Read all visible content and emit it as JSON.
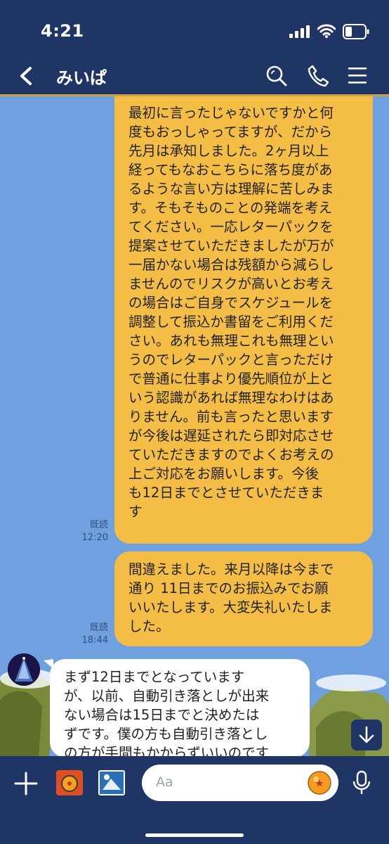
{
  "status_bar": {
    "time": "4:21"
  },
  "header": {
    "title": "みいぱ"
  },
  "messages": [
    {
      "direction": "outgoing",
      "read_label": "既読",
      "time": "12:20",
      "lines": [
        "最初に言ったじゃないですかと何",
        "度もおっしゃってますが、だから",
        "先月は承知しました。2ヶ月以上",
        "経ってもなおこちらに落ち度があ",
        "るような言い方は理解に苦しみま",
        "す。そもそものことの発端を考え",
        "てください。一応レターパックを",
        "提案させていただきましたが万が",
        "一届かない場合は残額から減らし",
        "ませんのでリスクが高いとお考え",
        "の場合はご自身でスケジュールを",
        "調整して振込か書留をご利用くだ",
        "さい。あれも無理これも無理とい",
        "うのでレターパックと言っただけ",
        "で普通に仕事より優先順位が上と",
        "いう認識があれば無理なわけはあ",
        "りません。前も言ったと思います",
        "が今後は遅延されたら即対応させ",
        "ていただきますのでよくお考えの",
        "上ご対応をお願いします。今後",
        "も12日までとさせていただきま",
        "す"
      ]
    },
    {
      "direction": "outgoing",
      "read_label": "既読",
      "time": "18:44",
      "lines": [
        "間違えました。来月以降は今まで",
        "通り 11日までのお振込みでお願",
        "いいたします。大変失礼いたしま",
        "した。"
      ]
    },
    {
      "direction": "incoming",
      "lines": [
        "まず12日までとなっています",
        "が、以前、自動引き落としが出来",
        "ない場合は15日までと決めたは",
        "ずです。僕の方も自動引き落とし",
        "の方が手間もかからずいいのです"
      ]
    }
  ],
  "input_bar": {
    "placeholder": "Aa"
  },
  "colors": {
    "header_bg": "#1f3566",
    "chat_bg": "#6fa0df",
    "outgoing_bubble": "#f4bd45",
    "incoming_bubble": "#ffffff",
    "accent_border": "#c9a24a"
  }
}
